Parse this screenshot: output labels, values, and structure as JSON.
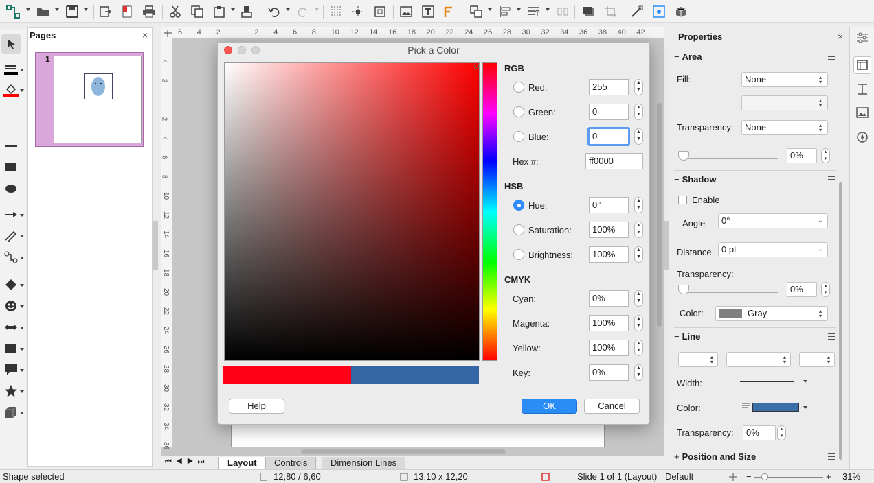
{
  "toolbar": {
    "icons": [
      "connector-icon",
      "open-icon",
      "save-icon",
      "export-icon",
      "export-pdf-icon",
      "print-icon",
      "cut-icon",
      "copy-icon",
      "paste-icon",
      "clone-formatting-icon",
      "undo-icon",
      "redo-icon",
      "grid-icon",
      "helplines-icon",
      "zoom-pan-icon",
      "image-icon",
      "textbox-icon",
      "fontwork-icon",
      "transform-icon",
      "align-icon",
      "arrange-icon",
      "distribute-icon",
      "shadow-icon",
      "crop-icon",
      "points-icon",
      "toggle-extrusion-icon",
      "3d-icon"
    ]
  },
  "pages_panel": {
    "title": "Pages",
    "page_number": "1"
  },
  "ruler": {
    "h": [
      "6",
      "4",
      "2",
      "2",
      "4",
      "6",
      "8",
      "10",
      "12",
      "14",
      "16",
      "18",
      "20",
      "22",
      "24",
      "26",
      "28",
      "30",
      "32",
      "34",
      "36",
      "38",
      "40",
      "42"
    ],
    "v": [
      "4",
      "2",
      "2",
      "4",
      "6",
      "8",
      "10",
      "12",
      "14",
      "16",
      "18",
      "20",
      "22",
      "24",
      "26",
      "28",
      "30",
      "32",
      "34",
      "36"
    ]
  },
  "tabs": [
    "Layout",
    "Controls",
    "Dimension Lines"
  ],
  "status": {
    "selection": "Shape selected",
    "position": "12,80 / 6,60",
    "size": "13,10 x 12,20",
    "slide": "Slide 1 of 1 (Layout)",
    "style": "Default",
    "zoom": "31%"
  },
  "properties": {
    "title": "Properties",
    "area": {
      "title": "Area",
      "fill_label": "Fill:",
      "fill_value": "None",
      "transparency_label": "Transparency:",
      "transparency_value": "None",
      "percent": "0%",
      "slider_value": 0
    },
    "shadow": {
      "title": "Shadow",
      "enable_label": "Enable",
      "angle_label": "Angle",
      "angle_value": "0°",
      "distance_label": "Distance",
      "distance_value": "0 pt",
      "transparency_label": "Transparency:",
      "percent": "0%",
      "slider_value": 0,
      "color_label": "Color:",
      "color_value": "Gray",
      "color_hex": "#808080"
    },
    "line": {
      "title": "Line",
      "width_label": "Width:",
      "color_label": "Color:",
      "color_hex": "#3b6ea8",
      "transparency_label": "Transparency:",
      "transparency_value": "0%"
    },
    "position": {
      "title": "Position and Size"
    }
  },
  "dialog": {
    "title": "Pick a Color",
    "rgb": {
      "title": "RGB",
      "red_label": "Red:",
      "red": "255",
      "green_label": "Green:",
      "green": "0",
      "blue_label": "Blue:",
      "blue": "0",
      "hex_label": "Hex #:",
      "hex": "ff0000"
    },
    "hsb": {
      "title": "HSB",
      "hue_label": "Hue:",
      "hue": "0°",
      "sat_label": "Saturation:",
      "sat": "100%",
      "bri_label": "Brightness:",
      "bri": "100%"
    },
    "cmyk": {
      "title": "CMYK",
      "cyan_label": "Cyan:",
      "cyan": "0%",
      "magenta_label": "Magenta:",
      "magenta": "100%",
      "yellow_label": "Yellow:",
      "yellow": "100%",
      "key_label": "Key:",
      "key": "0%"
    },
    "new_color": "#ff0018",
    "old_color": "#3465a4",
    "help": "Help",
    "ok": "OK",
    "cancel": "Cancel"
  }
}
